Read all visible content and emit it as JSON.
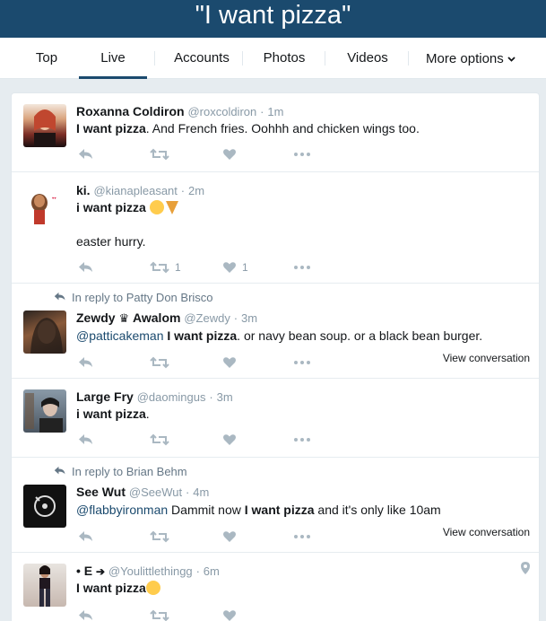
{
  "title": "\"I want pizza\"",
  "tabs": [
    {
      "label": "Top"
    },
    {
      "label": "Live"
    },
    {
      "label": "Accounts"
    },
    {
      "label": "Photos"
    },
    {
      "label": "Videos"
    },
    {
      "label": "More options"
    }
  ],
  "tweets": [
    {
      "name": "Roxanna Coldiron",
      "handle": "@roxcoldiron",
      "sep": "·",
      "time": "1m",
      "text_bold": "I want pizza",
      "text_rest": ". And French fries. Oohhh and chicken wings too."
    },
    {
      "name": "ki.",
      "handle": "@kianapleasant",
      "sep": "·",
      "time": "2m",
      "text_bold": "i want pizza",
      "line2": "easter hurry.",
      "retweets": "1",
      "likes": "1"
    },
    {
      "reply_to": "In reply to Patty Don Brisco",
      "name": "Zewdy",
      "name_suffix": "Awalom",
      "handle": "@Zewdy",
      "sep": "·",
      "time": "3m",
      "mention": "@patticakeman",
      "text_bold": "I want pizza",
      "text_rest": ". or navy bean soup. or a black bean burger.",
      "view_conversation": "View conversation"
    },
    {
      "name": "Large Fry",
      "handle": "@daomingus",
      "sep": "·",
      "time": "3m",
      "text_bold": "i want pizza",
      "text_rest": "."
    },
    {
      "reply_to": "In reply to Brian Behm",
      "name": "See Wut",
      "handle": "@SeeWut",
      "sep": "·",
      "time": "4m",
      "mention": "@flabbyironman",
      "text_pre": "Dammit now",
      "text_bold": "I want pizza",
      "text_rest": "and it's only like 10am",
      "view_conversation": "View conversation"
    },
    {
      "name": "• E",
      "handle": "@Youlittlethingg",
      "sep": "·",
      "time": "6m",
      "text_bold": "I want pizza"
    }
  ],
  "colors": {
    "header_bg": "#1b4a6e",
    "link": "#1b95e0",
    "icon": "#aab8c2",
    "muted": "#8899a6"
  },
  "icons": [
    "reply-icon",
    "retweet-icon",
    "like-icon",
    "more-icon",
    "location-pin-icon",
    "chevron-down-icon"
  ]
}
